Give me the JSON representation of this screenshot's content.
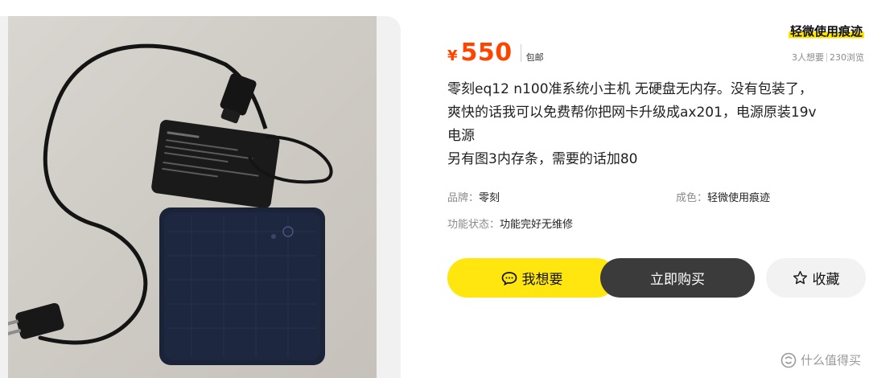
{
  "product": {
    "condition_tag": "轻微使用痕迹",
    "price_symbol": "¥",
    "price": "550",
    "shipping": "包邮",
    "wants": "3人想要",
    "views": "230浏览",
    "description_lines": [
      "零刻eq12 n100准系统小主机 无硬盘无内存。没有包装了，",
      "爽快的话我可以免费帮你把网卡升级成ax201，电源原装19v",
      "电源",
      "另有图3内存条，需要的话加80"
    ],
    "attributes": {
      "brand_key": "品牌：",
      "brand_value": "零刻",
      "condition_key": "成色：",
      "condition_value": "轻微使用痕迹",
      "function_key": "功能状态：",
      "function_value": "功能完好无维修"
    }
  },
  "actions": {
    "want_label": "我想要",
    "buy_label": "立即购买",
    "favorite_label": "收藏"
  },
  "watermark": {
    "text": "什么值得买"
  },
  "icons": {
    "want": "chat-bubble-icon",
    "favorite": "star-outline-icon",
    "watermark": "smzdm-logo-icon"
  },
  "colors": {
    "price": "#ff4400",
    "want_button": "#ffe60f",
    "buy_button": "#3b3b3b",
    "favorite_button": "#f2f2f2",
    "tag_highlight": "#ffe600"
  }
}
